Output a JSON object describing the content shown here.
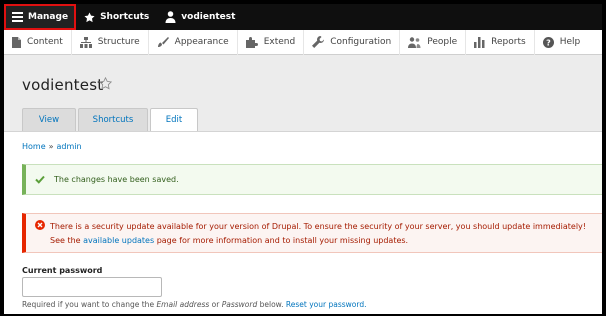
{
  "toolbar": {
    "manage_label": "Manage",
    "shortcuts_label": "Shortcuts",
    "user_label": "vodientest"
  },
  "menu": {
    "items": [
      {
        "label": "Content",
        "icon": "document-icon"
      },
      {
        "label": "Structure",
        "icon": "structure-icon"
      },
      {
        "label": "Appearance",
        "icon": "brush-icon"
      },
      {
        "label": "Extend",
        "icon": "puzzle-icon"
      },
      {
        "label": "Configuration",
        "icon": "wrench-icon"
      },
      {
        "label": "People",
        "icon": "people-icon"
      },
      {
        "label": "Reports",
        "icon": "bar-chart-icon"
      },
      {
        "label": "Help",
        "icon": "help-icon"
      }
    ]
  },
  "header": {
    "title": "vodientest",
    "tabs": [
      {
        "label": "View"
      },
      {
        "label": "Shortcuts"
      },
      {
        "label": "Edit",
        "active": true
      }
    ]
  },
  "breadcrumb": {
    "home": "Home",
    "separator": "»",
    "current": "admin"
  },
  "status_message": {
    "text": "The changes have been saved."
  },
  "error_message": {
    "line1": "There is a security update available for your version of Drupal. To ensure the security of your server, you should update immediately!",
    "line2_prefix": "See the ",
    "line2_link": "available updates",
    "line2_suffix": " page for more information and to install your missing updates."
  },
  "password": {
    "label": "Current password",
    "value": "",
    "help_prefix": "Required if you want to change the ",
    "help_email": "Email address",
    "help_or": " or ",
    "help_password": "Password",
    "help_below": " below. ",
    "help_link": "Reset your password."
  },
  "colors": {
    "toolbar_bg": "#0f0f0f",
    "manage_outline": "#e01010",
    "link": "#0074bd",
    "success_border": "#77b259",
    "error_border": "#e62600"
  }
}
